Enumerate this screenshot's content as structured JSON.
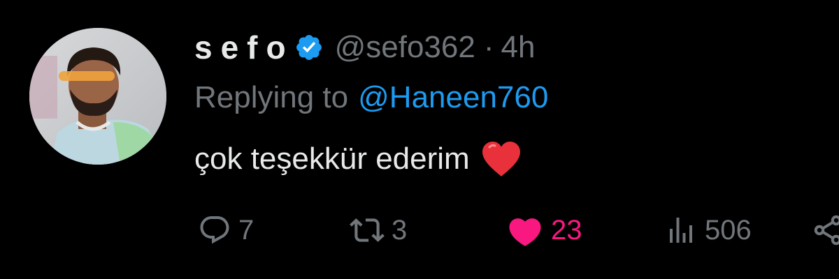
{
  "tweet": {
    "display_name": "sefo",
    "verified": true,
    "handle": "@sefo362",
    "separator": "·",
    "time": "4h",
    "replying_label": "Replying to",
    "replying_to": "@Haneen760",
    "text": "çok teşekkür ederim",
    "emoji": "red-heart-emoji"
  },
  "actions": {
    "reply_count": "7",
    "retweet_count": "3",
    "like_count": "23",
    "views_count": "506",
    "liked": true
  },
  "icons": {
    "reply": "reply-icon",
    "retweet": "retweet-icon",
    "like": "heart-icon",
    "views": "views-icon",
    "share": "share-icon",
    "verified": "verified-badge-icon"
  },
  "colors": {
    "background": "#000000",
    "primary_text": "#e7e9ea",
    "secondary_text": "#71767b",
    "mention": "#1d9bf0",
    "verified": "#1d9bf0",
    "like": "#f91880",
    "emoji_heart": "#e8313a"
  }
}
